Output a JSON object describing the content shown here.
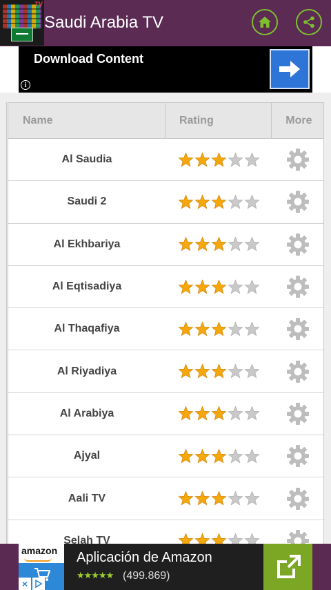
{
  "header": {
    "app_title": "Saudi Arabia TV",
    "app_icon_tag": "TV",
    "accent_color": "#7fbf2f",
    "background_color": "#5b2b54",
    "home_icon": "home-icon",
    "share_icon": "share-icon"
  },
  "top_ad": {
    "text": "Download Content",
    "info_symbol": "i",
    "arrow_icon": "arrow-right-icon",
    "arrow_color": "#2e75d8"
  },
  "table": {
    "columns": [
      "Name",
      "Rating",
      "More"
    ],
    "rows": [
      {
        "name": "Al Saudia",
        "rating": 3
      },
      {
        "name": "Saudi 2",
        "rating": 3
      },
      {
        "name": "Al Ekhbariya",
        "rating": 3
      },
      {
        "name": "Al Eqtisadiya",
        "rating": 3
      },
      {
        "name": "Al Thaqafiya",
        "rating": 3
      },
      {
        "name": "Al Riyadiya",
        "rating": 3
      },
      {
        "name": "Al Arabiya",
        "rating": 3
      },
      {
        "name": "Ajyal",
        "rating": 3
      },
      {
        "name": "Aali TV",
        "rating": 3
      },
      {
        "name": "Selah TV",
        "rating": 3
      }
    ],
    "rating_max": 5,
    "more_icon": "gear-icon",
    "star_on_color": "#f5a80c",
    "star_off_color": "#c9c9c9"
  },
  "bottom_ad": {
    "logo_text": "amazon",
    "title": "Aplicación de Amazon",
    "stars": "★★★★★",
    "rating_count": "(499.869)",
    "close_symbol": "×",
    "open_icon": "external-open-icon",
    "button_color": "#7ba724"
  }
}
